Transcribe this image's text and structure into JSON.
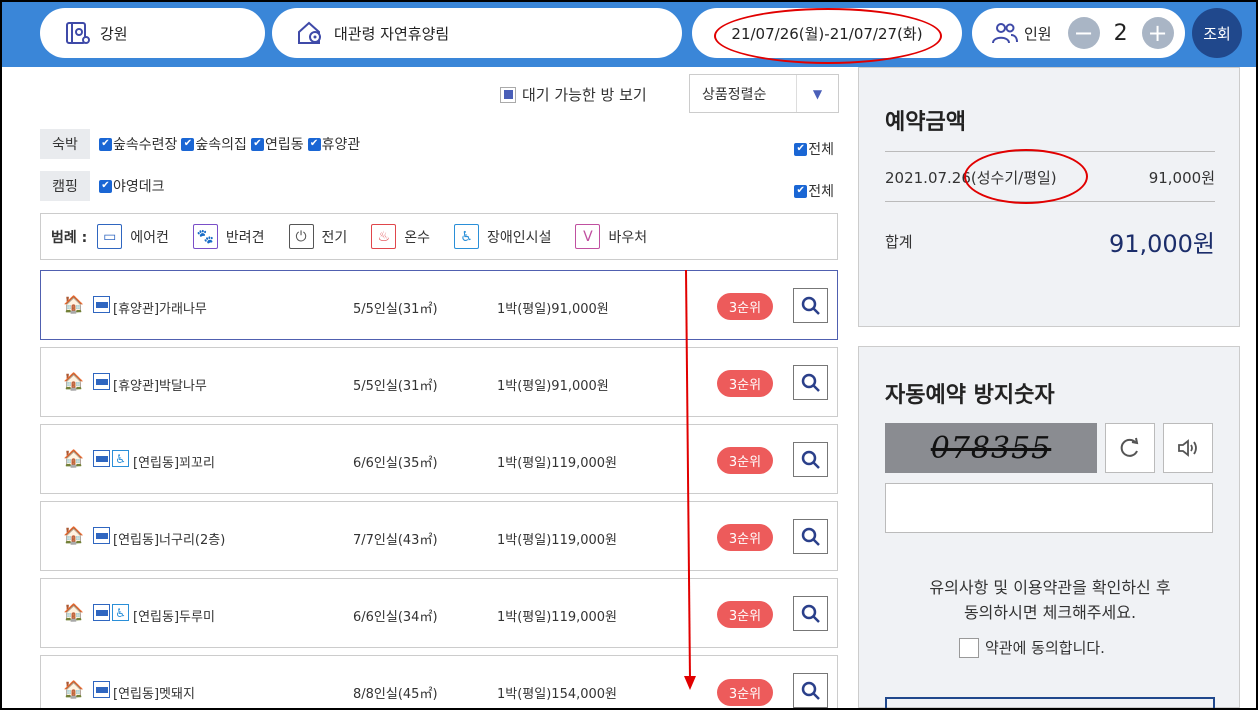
{
  "search_bar": {
    "region": "강원",
    "forest": "대관령 자연휴양림",
    "date_range": "21/07/26(월)-21/07/27(화)",
    "people_label": "인원",
    "people_count": "2",
    "minus_label": "−",
    "plus_label": "+",
    "search_label": "조회"
  },
  "filters": {
    "wait_toggle_label": "대기 가능한 방 보기",
    "sort_value": "상품정렬순",
    "stay_tag": "숙박",
    "stay_options": [
      "숲속수련장",
      "숲속의집",
      "연립동",
      "휴양관"
    ],
    "camp_tag": "캠핑",
    "camp_options": [
      "야영데크"
    ],
    "all_label": "전체",
    "checkmark": "✔"
  },
  "legend": {
    "title": "범례 :",
    "items": [
      {
        "label": "에어컨",
        "icon": "air-conditioner-icon",
        "glyph": "▭",
        "color": "#2f66c0"
      },
      {
        "label": "반려견",
        "icon": "pet-dog-icon",
        "glyph": "🐕",
        "color": "#7a4fc8"
      },
      {
        "label": "전기",
        "icon": "electric-plug-icon",
        "glyph": "⏻",
        "color": "#555555"
      },
      {
        "label": "온수",
        "icon": "hot-water-icon",
        "glyph": "♨",
        "color": "#e0464b"
      },
      {
        "label": "장애인시설",
        "icon": "wheelchair-icon",
        "glyph": "♿",
        "color": "#2a8fd8"
      },
      {
        "label": "바우처",
        "icon": "voucher-icon",
        "glyph": "V",
        "color": "#c050a0"
      }
    ]
  },
  "rooms": [
    {
      "name": "[휴양관]가래나무",
      "capacity": "5/5인실(31㎡)",
      "price": "1박(평일)91,000원",
      "rank": "3순위",
      "accessible": false
    },
    {
      "name": "[휴양관]박달나무",
      "capacity": "5/5인실(31㎡)",
      "price": "1박(평일)91,000원",
      "rank": "3순위",
      "accessible": false
    },
    {
      "name": "[연립동]꾀꼬리",
      "capacity": "6/6인실(35㎡)",
      "price": "1박(평일)119,000원",
      "rank": "3순위",
      "accessible": true
    },
    {
      "name": "[연립동]너구리(2층)",
      "capacity": "7/7인실(43㎡)",
      "price": "1박(평일)119,000원",
      "rank": "3순위",
      "accessible": false
    },
    {
      "name": "[연립동]두루미",
      "capacity": "6/6인실(34㎡)",
      "price": "1박(평일)119,000원",
      "rank": "3순위",
      "accessible": true
    },
    {
      "name": "[연립동]멧돼지",
      "capacity": "8/8인실(45㎡)",
      "price": "1박(평일)154,000원",
      "rank": "3순위",
      "accessible": false
    }
  ],
  "reservation": {
    "title": "예약금액",
    "line_date": "2021.07.26",
    "line_season": "(성수기/평일)",
    "line_amount": "91,000원",
    "total_label": "합계",
    "total_amount": "91,000원"
  },
  "captcha": {
    "title": "자동예약 방지숫자",
    "code": "078355",
    "refresh_icon": "refresh-icon",
    "audio_icon": "speaker-icon",
    "notice_line1": "유의사항 및 이용약관을 확인하신 후",
    "notice_line2": "동의하시면 체크해주세요.",
    "agree_label": "약관에 동의합니다."
  },
  "colors": {
    "topbar": "#3a86d8",
    "search_button": "#20488c",
    "rank_badge": "#ed5b5b",
    "checkbox": "#1a66d4",
    "annotation_red": "#e10000"
  }
}
